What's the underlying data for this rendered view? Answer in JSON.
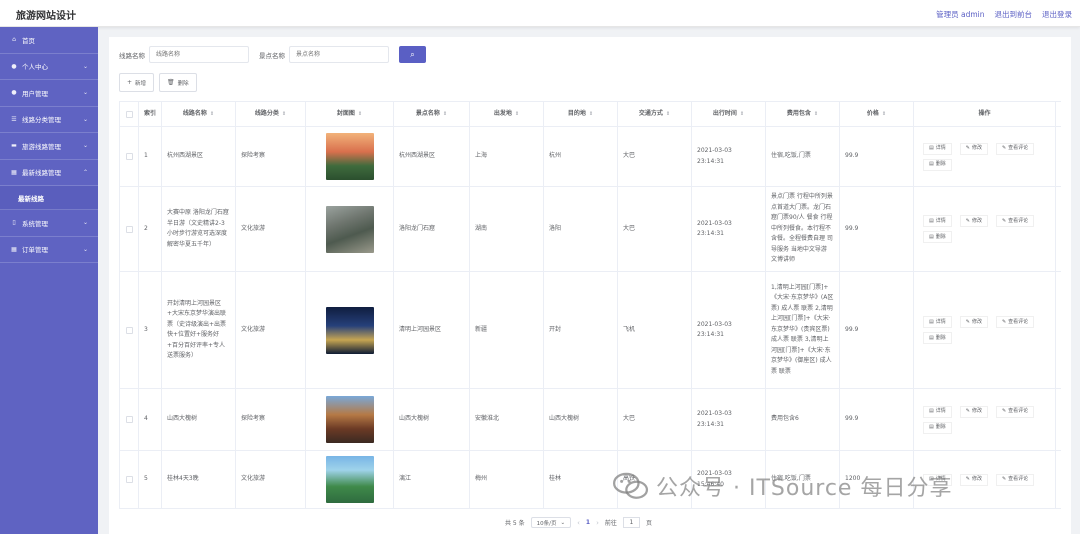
{
  "header": {
    "title": "旅游网站设计",
    "user": "管理员 admin",
    "back_to_front": "退出到前台",
    "logout": "退出登录"
  },
  "sidebar": {
    "items": [
      {
        "label": "首页",
        "icon": "home-icon"
      },
      {
        "label": "个人中心",
        "icon": "user-icon"
      },
      {
        "label": "用户管理",
        "icon": "user-icon"
      },
      {
        "label": "线路分类管理",
        "icon": "list-icon"
      },
      {
        "label": "旅游线路管理",
        "icon": "bus-icon"
      },
      {
        "label": "最新线路管理",
        "icon": "grid-icon"
      },
      {
        "label": "系统管理",
        "icon": "phone-icon"
      },
      {
        "label": "订单管理",
        "icon": "grid-icon"
      }
    ],
    "sub_item": "最新线路"
  },
  "search": {
    "route_label": "线路名称",
    "route_placeholder": "线路名称",
    "spot_label": "景点名称",
    "spot_placeholder": "景点名称"
  },
  "actions": {
    "add": "新增",
    "delete": "删除"
  },
  "columns": [
    "索引",
    "线路名称",
    "线路分类",
    "封面图",
    "景点名称",
    "出发地",
    "目的地",
    "交通方式",
    "出行时间",
    "费用包含",
    "价格",
    "操作"
  ],
  "op_labels": {
    "detail": "详情",
    "edit": "修改",
    "review": "查看评论",
    "delete": "删除"
  },
  "rows": [
    {
      "idx": "1",
      "name": "杭州西湖景区",
      "category": "探险考察",
      "spot": "杭州西湖景区",
      "from": "上海",
      "to": "杭州",
      "transport": "大巴",
      "time": "2021-03-03 23:14:31",
      "fee": "住宿,吃饭,门票",
      "price": "99.9"
    },
    {
      "idx": "2",
      "name": "大赛中原 洛阳龙门石窟半日游（文史精讲2-3小时步行游览可选深度解密华夏五千年）",
      "category": "文化旅游",
      "spot": "洛阳龙门石窟",
      "from": "湖南",
      "to": "洛阳",
      "transport": "大巴",
      "time": "2021-03-03 23:14:31",
      "fee": "景点门票 行程中所列景点首道大门票。龙门石窟门票90/人 餐食 行程中所列餐食。本行程不含餐。全程餐费自理 司导服务 当地中文导游 文博讲师",
      "price": "99.9"
    },
    {
      "idx": "3",
      "name": "开封清明上河园景区+大宋东京梦华演出联票（史诗级演出+出票快+位置好+服务好+百分百好评率+专人送票服务）",
      "category": "文化旅游",
      "spot": "清明上河园景区",
      "from": "新疆",
      "to": "开封",
      "transport": "飞机",
      "time": "2021-03-03 23:14:31",
      "fee": "1,清明上河园[门票]+《大宋·东京梦华》(A区票) 成人票 联票 2,清明上河园[门票]+《大宋·东京梦华》(贵宾区票) 成人票 联票 3,清明上河园[门票]+《大宋·东京梦华》(御座区) 成人票 联票",
      "price": "99.9"
    },
    {
      "idx": "4",
      "name": "山西大槐树",
      "category": "探险考察",
      "spot": "山西大槐树",
      "from": "安徽淮北",
      "to": "山西大槐树",
      "transport": "大巴",
      "time": "2021-03-03 23:14:31",
      "fee": "费用包含6",
      "price": "99.9"
    },
    {
      "idx": "5",
      "name": "桂林4天3晚",
      "category": "文化旅游",
      "spot": "漓江",
      "from": "梅州",
      "to": "桂林",
      "transport": "高铁",
      "time": "2021-03-03 15:46:40",
      "fee": "住宿,吃饭,门票",
      "price": "1200"
    }
  ],
  "pagination": {
    "total": "共 5 条",
    "page_size": "10条/页",
    "current_page": "1",
    "goto_label": "前往",
    "goto_value": "1",
    "page_unit": "页"
  },
  "watermark": "公众号 · ITSource 每日分享"
}
